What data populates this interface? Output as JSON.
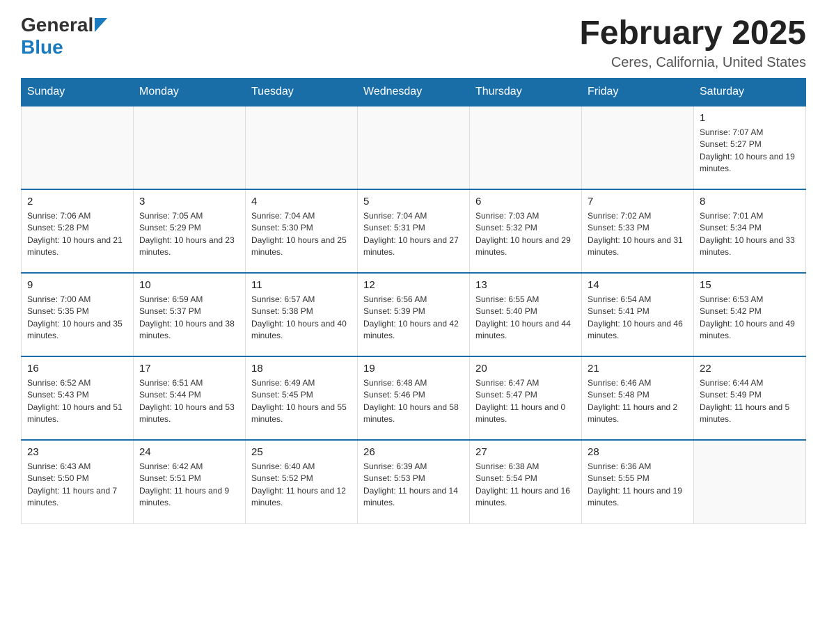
{
  "header": {
    "logo_general": "General",
    "logo_blue": "Blue",
    "month_title": "February 2025",
    "location": "Ceres, California, United States"
  },
  "days_of_week": [
    "Sunday",
    "Monday",
    "Tuesday",
    "Wednesday",
    "Thursday",
    "Friday",
    "Saturday"
  ],
  "weeks": [
    [
      {
        "day": "",
        "info": ""
      },
      {
        "day": "",
        "info": ""
      },
      {
        "day": "",
        "info": ""
      },
      {
        "day": "",
        "info": ""
      },
      {
        "day": "",
        "info": ""
      },
      {
        "day": "",
        "info": ""
      },
      {
        "day": "1",
        "info": "Sunrise: 7:07 AM\nSunset: 5:27 PM\nDaylight: 10 hours and 19 minutes."
      }
    ],
    [
      {
        "day": "2",
        "info": "Sunrise: 7:06 AM\nSunset: 5:28 PM\nDaylight: 10 hours and 21 minutes."
      },
      {
        "day": "3",
        "info": "Sunrise: 7:05 AM\nSunset: 5:29 PM\nDaylight: 10 hours and 23 minutes."
      },
      {
        "day": "4",
        "info": "Sunrise: 7:04 AM\nSunset: 5:30 PM\nDaylight: 10 hours and 25 minutes."
      },
      {
        "day": "5",
        "info": "Sunrise: 7:04 AM\nSunset: 5:31 PM\nDaylight: 10 hours and 27 minutes."
      },
      {
        "day": "6",
        "info": "Sunrise: 7:03 AM\nSunset: 5:32 PM\nDaylight: 10 hours and 29 minutes."
      },
      {
        "day": "7",
        "info": "Sunrise: 7:02 AM\nSunset: 5:33 PM\nDaylight: 10 hours and 31 minutes."
      },
      {
        "day": "8",
        "info": "Sunrise: 7:01 AM\nSunset: 5:34 PM\nDaylight: 10 hours and 33 minutes."
      }
    ],
    [
      {
        "day": "9",
        "info": "Sunrise: 7:00 AM\nSunset: 5:35 PM\nDaylight: 10 hours and 35 minutes."
      },
      {
        "day": "10",
        "info": "Sunrise: 6:59 AM\nSunset: 5:37 PM\nDaylight: 10 hours and 38 minutes."
      },
      {
        "day": "11",
        "info": "Sunrise: 6:57 AM\nSunset: 5:38 PM\nDaylight: 10 hours and 40 minutes."
      },
      {
        "day": "12",
        "info": "Sunrise: 6:56 AM\nSunset: 5:39 PM\nDaylight: 10 hours and 42 minutes."
      },
      {
        "day": "13",
        "info": "Sunrise: 6:55 AM\nSunset: 5:40 PM\nDaylight: 10 hours and 44 minutes."
      },
      {
        "day": "14",
        "info": "Sunrise: 6:54 AM\nSunset: 5:41 PM\nDaylight: 10 hours and 46 minutes."
      },
      {
        "day": "15",
        "info": "Sunrise: 6:53 AM\nSunset: 5:42 PM\nDaylight: 10 hours and 49 minutes."
      }
    ],
    [
      {
        "day": "16",
        "info": "Sunrise: 6:52 AM\nSunset: 5:43 PM\nDaylight: 10 hours and 51 minutes."
      },
      {
        "day": "17",
        "info": "Sunrise: 6:51 AM\nSunset: 5:44 PM\nDaylight: 10 hours and 53 minutes."
      },
      {
        "day": "18",
        "info": "Sunrise: 6:49 AM\nSunset: 5:45 PM\nDaylight: 10 hours and 55 minutes."
      },
      {
        "day": "19",
        "info": "Sunrise: 6:48 AM\nSunset: 5:46 PM\nDaylight: 10 hours and 58 minutes."
      },
      {
        "day": "20",
        "info": "Sunrise: 6:47 AM\nSunset: 5:47 PM\nDaylight: 11 hours and 0 minutes."
      },
      {
        "day": "21",
        "info": "Sunrise: 6:46 AM\nSunset: 5:48 PM\nDaylight: 11 hours and 2 minutes."
      },
      {
        "day": "22",
        "info": "Sunrise: 6:44 AM\nSunset: 5:49 PM\nDaylight: 11 hours and 5 minutes."
      }
    ],
    [
      {
        "day": "23",
        "info": "Sunrise: 6:43 AM\nSunset: 5:50 PM\nDaylight: 11 hours and 7 minutes."
      },
      {
        "day": "24",
        "info": "Sunrise: 6:42 AM\nSunset: 5:51 PM\nDaylight: 11 hours and 9 minutes."
      },
      {
        "day": "25",
        "info": "Sunrise: 6:40 AM\nSunset: 5:52 PM\nDaylight: 11 hours and 12 minutes."
      },
      {
        "day": "26",
        "info": "Sunrise: 6:39 AM\nSunset: 5:53 PM\nDaylight: 11 hours and 14 minutes."
      },
      {
        "day": "27",
        "info": "Sunrise: 6:38 AM\nSunset: 5:54 PM\nDaylight: 11 hours and 16 minutes."
      },
      {
        "day": "28",
        "info": "Sunrise: 6:36 AM\nSunset: 5:55 PM\nDaylight: 11 hours and 19 minutes."
      },
      {
        "day": "",
        "info": ""
      }
    ]
  ]
}
